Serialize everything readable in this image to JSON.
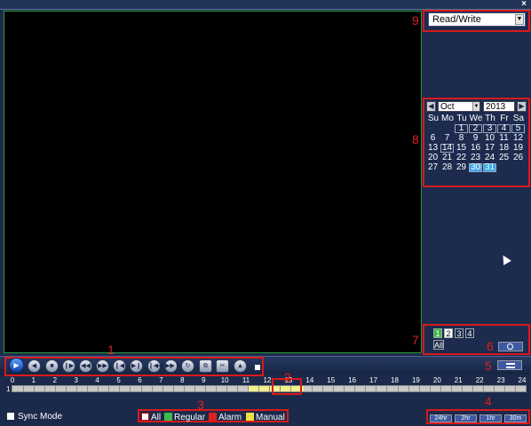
{
  "mode": {
    "value": "Read/Write"
  },
  "calendar": {
    "month": "Oct",
    "year": "2013",
    "weekdays": [
      "Su",
      "Mo",
      "Tu",
      "We",
      "Th",
      "Fr",
      "Sa"
    ],
    "rows": [
      [
        "",
        "",
        "1",
        "2",
        "3",
        "4",
        "5"
      ],
      [
        "6",
        "7",
        "8",
        "9",
        "10",
        "11",
        "12"
      ],
      [
        "13",
        "14",
        "15",
        "16",
        "17",
        "18",
        "19"
      ],
      [
        "20",
        "21",
        "22",
        "23",
        "24",
        "25",
        "26"
      ],
      [
        "27",
        "28",
        "29",
        "30",
        "31",
        "",
        ""
      ]
    ],
    "selected_day": "30",
    "today_day": "31"
  },
  "channels": {
    "labels": [
      "1",
      "2",
      "3",
      "4"
    ],
    "all_label": "All"
  },
  "timeline": {
    "channel_label": "1",
    "hours": [
      "0",
      "1",
      "2",
      "3",
      "4",
      "5",
      "6",
      "7",
      "8",
      "9",
      "10",
      "11",
      "12",
      "13",
      "14",
      "15",
      "16",
      "17",
      "18",
      "19",
      "20",
      "21",
      "22",
      "23",
      "24"
    ],
    "recordings": [
      {
        "start_hour": 11.0,
        "end_hour": 13.6,
        "color": "#f2f08a"
      }
    ]
  },
  "sync_mode_label": "Sync Mode",
  "legend": {
    "all": "All",
    "regular": "Regular",
    "alarm": "Alarm",
    "manual": "Manual"
  },
  "zoom": [
    "24hr",
    "2hr",
    "1hr",
    "30m"
  ],
  "callouts": [
    "1",
    "2",
    "3",
    "4",
    "5",
    "6",
    "7",
    "8",
    "9"
  ],
  "close_glyph": "×",
  "colors": {
    "green": "#3fb94a",
    "red": "#e02020",
    "yellow": "#f0e040",
    "accent": "#3d5aa2"
  }
}
